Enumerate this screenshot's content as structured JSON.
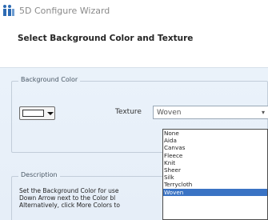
{
  "window": {
    "title": "5D Configure Wizard"
  },
  "header": {
    "heading": "Select Background Color and Texture"
  },
  "background_group": {
    "legend": "Background Color",
    "texture_label": "Texture",
    "texture_value": "Woven",
    "texture_arrow": "▾"
  },
  "description_group": {
    "legend": "Description",
    "lines": [
      "Set the Background Color for use",
      "Down Arrow next to the Color bl",
      "Alternatively, click More Colors to"
    ]
  },
  "texture_options": [
    "None",
    "Aida",
    "Canvas",
    "Fleece",
    "Knit",
    "Sheer",
    "Silk",
    "Terrycloth",
    "Woven"
  ],
  "selected_option": "Woven",
  "colors": {
    "selection": "#3a73c4",
    "panel": "#e8f0f9"
  },
  "icons": {
    "app": "app-logo-icon",
    "dropdown": "chevron-down-icon"
  }
}
